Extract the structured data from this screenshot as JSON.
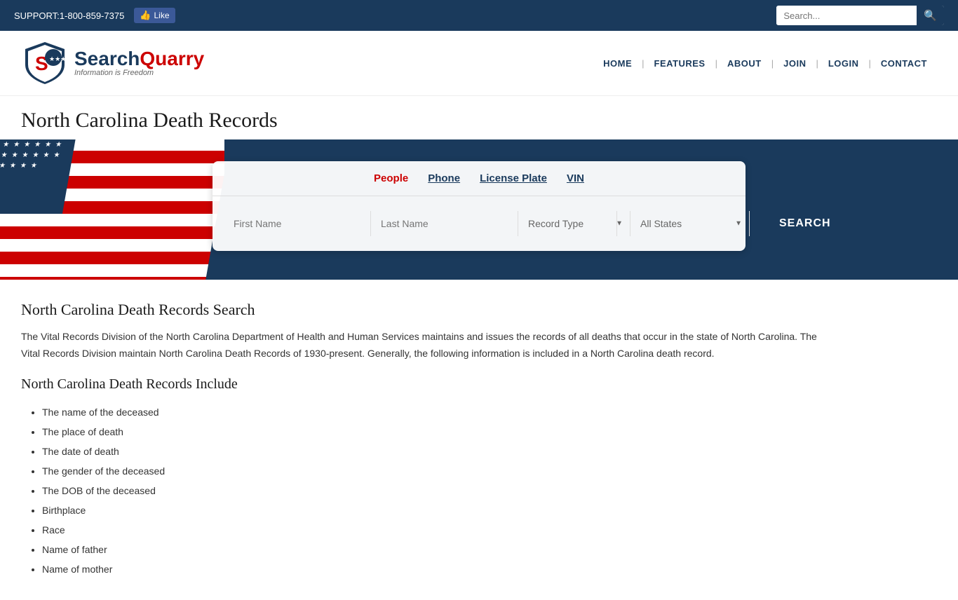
{
  "topbar": {
    "support_text": "SUPPORT:1-800-859-7375",
    "like_label": "Like",
    "search_placeholder": "Search..."
  },
  "nav": {
    "home": "HOME",
    "features": "FEATURES",
    "about": "ABOUT",
    "join": "JOIN",
    "login": "LOGIN",
    "contact": "CONTACT"
  },
  "logo": {
    "brand": "SearchQuarry",
    "tagline": "Information is Freedom"
  },
  "page": {
    "title": "North Carolina Death Records"
  },
  "search": {
    "tabs": [
      {
        "id": "people",
        "label": "People",
        "active": true
      },
      {
        "id": "phone",
        "label": "Phone",
        "active": false
      },
      {
        "id": "license_plate",
        "label": "License Plate",
        "active": false
      },
      {
        "id": "vin",
        "label": "VIN",
        "active": false
      }
    ],
    "first_name_placeholder": "First Name",
    "last_name_placeholder": "Last Name",
    "record_type_placeholder": "Record Type",
    "all_states_placeholder": "All States",
    "search_button": "SEARCH"
  },
  "content": {
    "heading": "North Carolina Death Records Search",
    "body": "The Vital Records Division of the North Carolina Department of Health and Human Services maintains and issues the records of all deaths that occur in the state of North Carolina. The Vital Records Division maintain North Carolina Death Records of 1930-present. Generally, the following information is included in a North Carolina death record.",
    "includes_heading": "North Carolina Death Records Include",
    "items": [
      "The name of the deceased",
      "The place of death",
      "The date of death",
      "The gender of the deceased",
      "The DOB of the deceased",
      "Birthplace",
      "Race",
      "Name of father",
      "Name of mother"
    ]
  }
}
